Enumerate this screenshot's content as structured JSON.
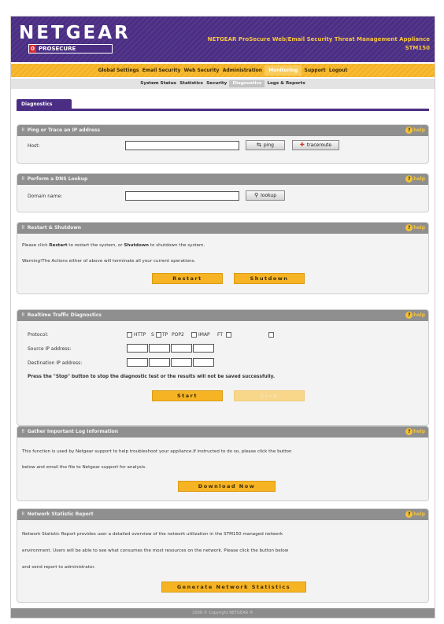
{
  "header": {
    "logo_text": "NETGEAR",
    "logo_badge_prefix": "0",
    "logo_badge_text": "PROSECURE",
    "product_line1": "NETGEAR ProSecure Web/Email Security Threat Management Appliance",
    "product_line2": "STM150"
  },
  "nav_main": [
    "Global Settings",
    "Email Security",
    "Web Security",
    "Administration",
    "Monitoring",
    "Support",
    "Logout"
  ],
  "nav_sub": [
    "System Status",
    "Statistics",
    "Security",
    "Diagnostics",
    "Logs & Reports"
  ],
  "tab": "Diagnostics",
  "help_label": "help",
  "sections": {
    "ping": {
      "title": "Ping or Trace an IP address",
      "host_label": "Host:",
      "host_value": "",
      "ping_button": "ping",
      "traceroute_button": "traceroute"
    },
    "dns": {
      "title": "Perform a DNS Lookup",
      "domain_label": "Domain name:",
      "domain_value": "",
      "lookup_button": "lookup"
    },
    "restart": {
      "title": "Restart & Shutdown",
      "line1_a": "Please click ",
      "line1_b": "Restart",
      "line1_c": " to restart the system, or ",
      "line1_d": "Shutdown",
      "line1_e": " to shutdown the system.",
      "warning": "Warning!The Actions either of above will terminate all your current operations.",
      "restart_button": "Restart",
      "shutdown_button": "Shutdown"
    },
    "traffic": {
      "title": "Realtime Traffic Diagnostics",
      "protocol_label": "Protocol:",
      "protocols": [
        "HTTP",
        "S",
        "TP",
        "POP2",
        "IMAP",
        "FT"
      ],
      "source_label": "Source IP address:",
      "dest_label": "Destination IP address:",
      "stop_note": "Press the \"Stop\" button to stop the diagnostic test or the results will not be saved successfully.",
      "start_button": "Start",
      "stop_button": "Stop"
    },
    "logs": {
      "title": "Gather Important Log Information",
      "line1": "This function is used by Netgear support to help troubleshoot your appliance.If instructed to do so, please click the button",
      "line2": "below and email the file to Netgear support for analysis.",
      "download_button": "Download Now"
    },
    "netstat": {
      "title": "Network Statistic Report",
      "line1": "Network Statistic Report provides user a detailed overview of the network utilization in the STM150 managed network",
      "line2": "environment. Users will be able to see what consumes the most resources on the network. Please click the button below",
      "line3": "and send report to administrator.",
      "generate_button": "Generate Network Statistics"
    }
  },
  "footer": "2008 © Copyright NETGEAR ®"
}
